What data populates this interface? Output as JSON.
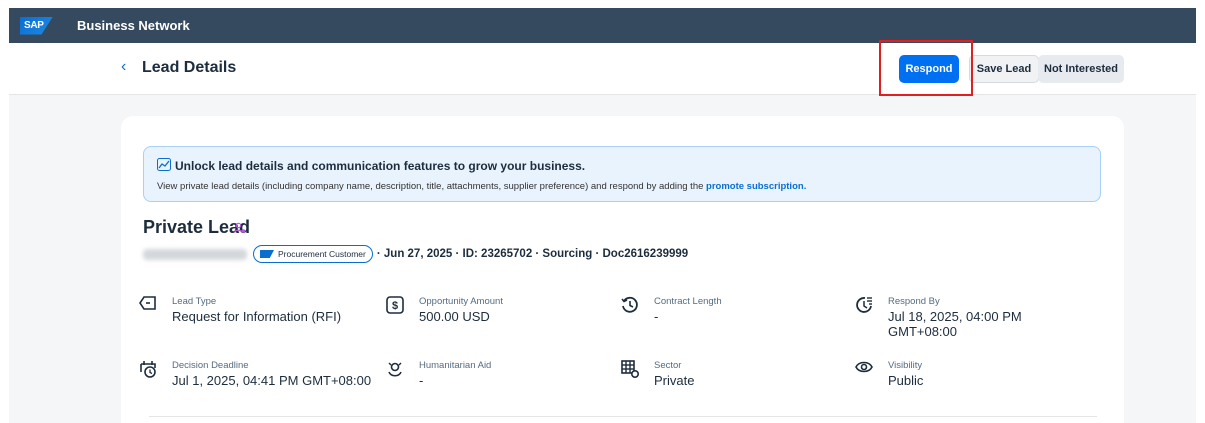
{
  "shell": {
    "logo": "SAP",
    "brand": "Business Network"
  },
  "header": {
    "back_icon": "‹",
    "title": "Lead Details",
    "buttons": {
      "respond": "Respond",
      "save": "Save Lead",
      "not_interested": "Not Interested"
    }
  },
  "banner": {
    "title": "Unlock lead details and communication features to grow your business.",
    "text": "View private lead details (including company name, description, title, attachments, supplier preference) and respond by adding the",
    "link": "promote subscription",
    "link_suffix": "."
  },
  "lead": {
    "title": "Private Lead",
    "badge": "Procurement Customer",
    "meta": "· Jun 27, 2025 · ID: 23265702 · Sourcing · Doc2616239999"
  },
  "fields": [
    {
      "icon": "lead-type-icon",
      "label": "Lead Type",
      "value": "Request for Information (RFI)"
    },
    {
      "icon": "money-icon",
      "label": "Opportunity Amount",
      "value": "500.00 USD"
    },
    {
      "icon": "history-icon",
      "label": "Contract Length",
      "value": "-"
    },
    {
      "icon": "respond-by-icon",
      "label": "Respond By",
      "value": "Jul 18, 2025, 04:00 PM",
      "value2": "GMT+08:00"
    },
    {
      "icon": "calendar-clock-icon",
      "label": "Decision Deadline",
      "value": "Jul 1, 2025, 04:41 PM GMT+08:00"
    },
    {
      "icon": "aid-icon",
      "label": "Humanitarian Aid",
      "value": "-"
    },
    {
      "icon": "sector-icon",
      "label": "Sector",
      "value": "Private"
    },
    {
      "icon": "eye-icon",
      "label": "Visibility",
      "value": "Public"
    }
  ],
  "colors": {
    "shell": "#354a5f",
    "accent": "#0070f2",
    "highlight": "#e02020",
    "banner": "#e8f3fd"
  }
}
